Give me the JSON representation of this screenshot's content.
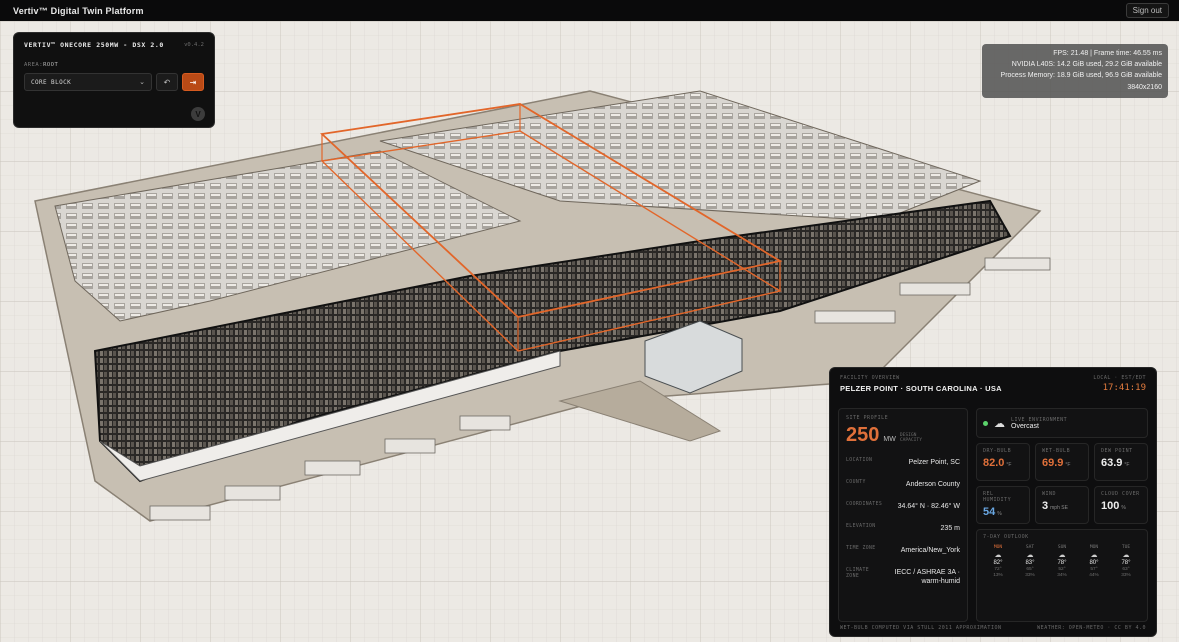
{
  "header": {
    "title": "Vertiv™ Digital Twin Platform",
    "sign_out": "Sign out"
  },
  "control_panel": {
    "title": "VERTIV™ ONECORE 250MW - DSX 2.0",
    "version": "v0.4.2",
    "area_label": "AREA:",
    "area_value": "ROOT",
    "selected_option": "CORE BLOCK",
    "undo_icon": "undo-icon",
    "focus_icon": "focus-icon"
  },
  "perf": {
    "line1": "FPS: 21.48 | Frame time: 46.55 ms",
    "line2": "NVIDIA L40S: 14.2 GiB used, 29.2 GiB available",
    "line3": "Process Memory: 18.9 GiB used, 96.9 GiB available",
    "line4": "3840x2160"
  },
  "facility": {
    "header_label": "FACILITY OVERVIEW",
    "name": "PELZER POINT · SOUTH CAROLINA · USA",
    "local_label": "LOCAL · EST/EDT",
    "time": "17:41:19",
    "site_profile_label": "SITE PROFILE",
    "capacity_value": "250",
    "capacity_unit": "MW",
    "capacity_note": "DESIGN CAPACITY",
    "details": [
      {
        "key": "LOCATION",
        "value": "Pelzer Point, SC"
      },
      {
        "key": "COUNTY",
        "value": "Anderson County"
      },
      {
        "key": "COORDINATES",
        "value": "34.64° N · 82.46° W"
      },
      {
        "key": "ELEVATION",
        "value": "235 m"
      },
      {
        "key": "TIME ZONE",
        "value": "America/New_York"
      },
      {
        "key": "CLIMATE ZONE",
        "value": "IECC / ASHRAE 3A · warm-humid"
      }
    ],
    "live_label": "LIVE ENVIRONMENT",
    "live_value": "Overcast",
    "metrics": [
      {
        "label": "DRY-BULB",
        "value": "82.0",
        "unit": "°F",
        "tone": "orange"
      },
      {
        "label": "WET-BULB",
        "value": "69.9",
        "unit": "°F",
        "tone": "orange"
      },
      {
        "label": "DEW POINT",
        "value": "63.9",
        "unit": "°F",
        "tone": "white"
      },
      {
        "label": "REL HUMIDITY",
        "value": "54",
        "unit": "%",
        "tone": "blue"
      },
      {
        "label": "WIND",
        "value": "3",
        "unit": "mph SE",
        "tone": "white"
      },
      {
        "label": "CLOUD COVER",
        "value": "100",
        "unit": "%",
        "tone": "white"
      }
    ],
    "outlook_label": "7-DAY OUTLOOK",
    "forecast": [
      {
        "day": "MON",
        "hi": "82°",
        "lo": "72°",
        "p": "13%"
      },
      {
        "day": "SAT",
        "hi": "83°",
        "lo": "65°",
        "p": "33%"
      },
      {
        "day": "SUN",
        "hi": "78°",
        "lo": "52°",
        "p": "34%"
      },
      {
        "day": "MON",
        "hi": "80°",
        "lo": "57°",
        "p": "44%"
      },
      {
        "day": "TUE",
        "hi": "78°",
        "lo": "63°",
        "p": "33%"
      }
    ],
    "footer_left": "WET-BULB COMPUTED VIA STULL 2011 APPROXIMATION",
    "footer_right": "WEATHER: OPEN-METEO · CC BY 4.0"
  },
  "colors": {
    "accent": "#e0703a",
    "panel": "#0e0e0f",
    "ground": "#ece9e4"
  }
}
